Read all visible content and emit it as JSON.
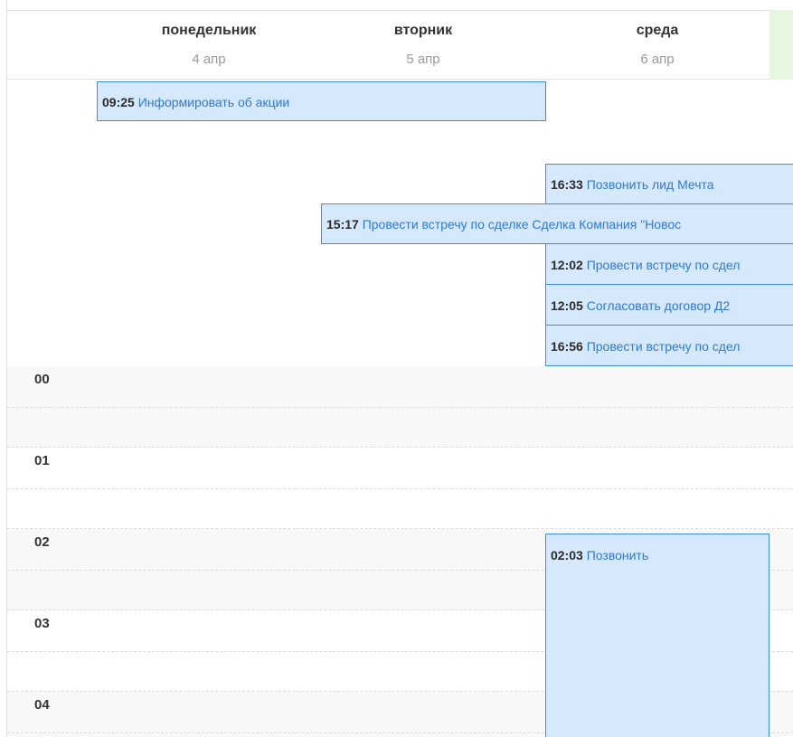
{
  "days": [
    {
      "name": "понедельник",
      "date": "4 апр"
    },
    {
      "name": "вторник",
      "date": "5 апр"
    },
    {
      "name": "среда",
      "date": "6 апр"
    }
  ],
  "allday_events": [
    {
      "time": "09:25",
      "title": "Информировать об акции"
    },
    {
      "time": "16:33",
      "title": "Позвонить лид Мечта"
    },
    {
      "time": "15:17",
      "title": "Провести встречу по сделке Сделка Компания \"Новос"
    },
    {
      "time": "12:02",
      "title": "Провести встречу по сдел"
    },
    {
      "time": "12:05",
      "title": "Согласовать договор Д2"
    },
    {
      "time": "16:56",
      "title": "Провести встречу по сдел"
    }
  ],
  "hours": [
    "00",
    "01",
    "02",
    "03",
    "04"
  ],
  "timed_events": [
    {
      "time": "02:03",
      "title": "Позвонить"
    }
  ],
  "colors": {
    "event_bg": "#d6e8fc",
    "event_border": "#3a8ee6",
    "event_text": "#2e7ad1",
    "today_highlight": "#e6f7df"
  }
}
